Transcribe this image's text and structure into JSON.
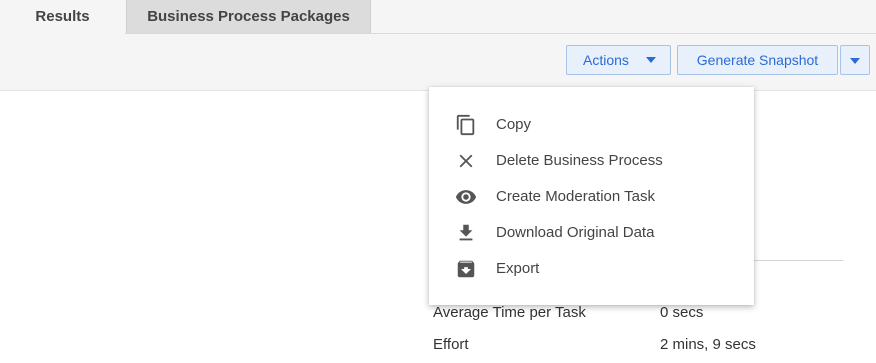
{
  "tabs": [
    {
      "label": "Results",
      "active": true
    },
    {
      "label": "Business Process Packages",
      "active": false
    }
  ],
  "toolbar": {
    "actions_label": "Actions",
    "snapshot_label": "Generate Snapshot"
  },
  "menu": {
    "items": [
      {
        "label": "Copy",
        "icon": "copy-icon"
      },
      {
        "label": "Delete Business Process",
        "icon": "close-icon"
      },
      {
        "label": "Create Moderation Task",
        "icon": "eye-icon"
      },
      {
        "label": "Download Original Data",
        "icon": "download-icon"
      },
      {
        "label": "Export",
        "icon": "archive-icon"
      }
    ]
  },
  "stats": [
    {
      "label": "Average Time per Task",
      "value": "0 secs"
    },
    {
      "label": "Effort",
      "value": "2 mins, 9 secs"
    }
  ],
  "colors": {
    "accent": "#2b6bd6",
    "button_bg": "#e8f0fb",
    "toolbar_bg": "#f5f5f5"
  }
}
